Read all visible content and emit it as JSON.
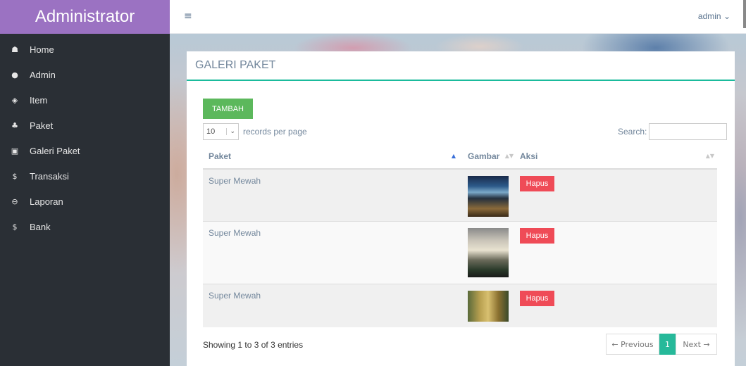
{
  "sidebar": {
    "brand": "Administrator",
    "items": [
      {
        "label": "Home",
        "icon": "home-icon",
        "glyph": "☗"
      },
      {
        "label": "Admin",
        "icon": "user-icon",
        "glyph": "●"
      },
      {
        "label": "Item",
        "icon": "shield-icon",
        "glyph": "◈"
      },
      {
        "label": "Paket",
        "icon": "group-icon",
        "glyph": "♣"
      },
      {
        "label": "Galeri Paket",
        "icon": "image-icon",
        "glyph": "▣"
      },
      {
        "label": "Transaksi",
        "icon": "dollar-icon",
        "glyph": "$"
      },
      {
        "label": "Laporan",
        "icon": "print-icon",
        "glyph": "⊖"
      },
      {
        "label": "Bank",
        "icon": "dollar-icon",
        "glyph": "$"
      }
    ]
  },
  "topnav": {
    "menu_glyph": "≡",
    "user": "admin ⌄"
  },
  "panel": {
    "title": "GALERI PAKET",
    "add_button": "TAMBAH",
    "length": {
      "value": "10",
      "suffix": "records per page",
      "chevron": "⌄"
    },
    "search_label": "Search:",
    "columns": [
      "Paket",
      "Gambar",
      "Aksi"
    ],
    "rows": [
      {
        "paket": "Super Mewah",
        "action": "Hapus"
      },
      {
        "paket": "Super Mewah",
        "action": "Hapus"
      },
      {
        "paket": "Super Mewah",
        "action": "Hapus"
      }
    ],
    "info": "Showing 1 to 3 of 3 entries",
    "pagination": {
      "prev": "← Previous",
      "current": "1",
      "next": "Next →"
    }
  },
  "colors": {
    "brand": "#9b72c2",
    "sidebar": "#2a2f35",
    "accent": "#1abb9c",
    "add": "#5cb85c",
    "delete": "#ef4b57"
  }
}
